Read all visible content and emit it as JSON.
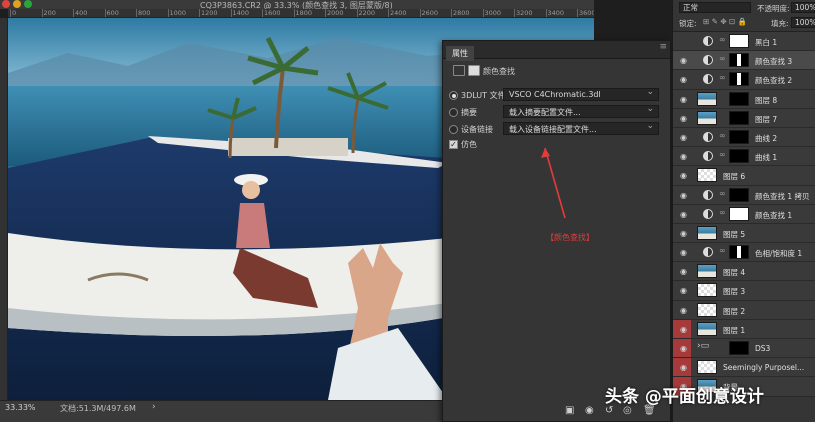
{
  "window": {
    "title": "CQ3P3863.CR2 @ 33.3% (颜色查找 3, 图层蒙版/8)",
    "ruler_ticks": [
      "0",
      "200",
      "400",
      "600",
      "800",
      "1000",
      "1200",
      "1400",
      "1600",
      "1800",
      "2000",
      "2200",
      "2400",
      "2600",
      "2800",
      "3000",
      "3200",
      "3400",
      "3600"
    ]
  },
  "status": {
    "zoom": "33.33%",
    "doc_size": "文档:51.3M/497.6M",
    "arrow": "›"
  },
  "properties": {
    "tab": "属性",
    "menu": "≡",
    "adjustment_type": "颜色查找",
    "rows": [
      {
        "label": "3DLUT 文件",
        "value": "VSCO C4Chromatic.3dl",
        "selected": true
      },
      {
        "label": "摘要",
        "value": "载入摘要配置文件...",
        "selected": false
      },
      {
        "label": "设备链接",
        "value": "载入设备链接配置文件...",
        "selected": false
      }
    ],
    "dither_label": "仿色",
    "dither_checked": "✓"
  },
  "annotation": {
    "label": "【颜色查找】",
    "color": "#e53b3b"
  },
  "layers_panel": {
    "blend_mode": "正常",
    "opacity_label": "不透明度:",
    "opacity_value": "100%",
    "lock_label": "锁定:",
    "fill_label": "填充:",
    "fill_value": "100%",
    "layers": [
      {
        "name": "黑白 1",
        "kind": "adjustment",
        "mask": "white",
        "selected": false,
        "visible": false
      },
      {
        "name": "颜色查找 3",
        "kind": "adjustment",
        "mask": "partial",
        "selected": true,
        "visible": true
      },
      {
        "name": "颜色查找 2",
        "kind": "adjustment",
        "mask": "partial",
        "selected": false,
        "visible": true
      },
      {
        "name": "图层 8",
        "kind": "pixel",
        "mask": "dark",
        "selected": false,
        "visible": true
      },
      {
        "name": "图层 7",
        "kind": "pixel",
        "mask": "black",
        "selected": false,
        "visible": true
      },
      {
        "name": "曲线 2",
        "kind": "adjustment",
        "mask": "black",
        "selected": false,
        "visible": true
      },
      {
        "name": "曲线 1",
        "kind": "adjustment",
        "mask": "black",
        "selected": false,
        "visible": true
      },
      {
        "name": "图层 6",
        "kind": "empty",
        "mask": "",
        "selected": false,
        "visible": true
      },
      {
        "name": "颜色查找 1 拷贝",
        "kind": "adjustment",
        "mask": "black",
        "selected": false,
        "visible": true
      },
      {
        "name": "颜色查找 1",
        "kind": "adjustment",
        "mask": "white",
        "selected": false,
        "visible": true
      },
      {
        "name": "图层 5",
        "kind": "pixel",
        "mask": "",
        "selected": false,
        "visible": true
      },
      {
        "name": "色相/饱和度 1",
        "kind": "adjustment",
        "mask": "partial",
        "selected": false,
        "visible": true
      },
      {
        "name": "图层 4",
        "kind": "pixel",
        "mask": "",
        "selected": false,
        "visible": true
      },
      {
        "name": "图层 3",
        "kind": "empty",
        "mask": "",
        "selected": false,
        "visible": true
      },
      {
        "name": "图层 2",
        "kind": "empty",
        "mask": "",
        "selected": false,
        "visible": true
      },
      {
        "name": "图层 1",
        "kind": "pixel",
        "mask": "",
        "selected": false,
        "visible": true,
        "red": true
      },
      {
        "name": "DS3",
        "kind": "group",
        "mask": "",
        "selected": false,
        "visible": true,
        "red": true
      },
      {
        "name": "Seemingly Purposel...",
        "kind": "empty",
        "mask": "",
        "selected": false,
        "visible": true,
        "red": true
      },
      {
        "name": "背景",
        "kind": "pixel",
        "mask": "",
        "selected": false,
        "visible": true,
        "red": true
      }
    ]
  },
  "watermark": "头条 @平面创意设计",
  "colors": {
    "sky": "#3f8fb4",
    "sea": "#1c5b7c",
    "annotation": "#e53b3b"
  }
}
